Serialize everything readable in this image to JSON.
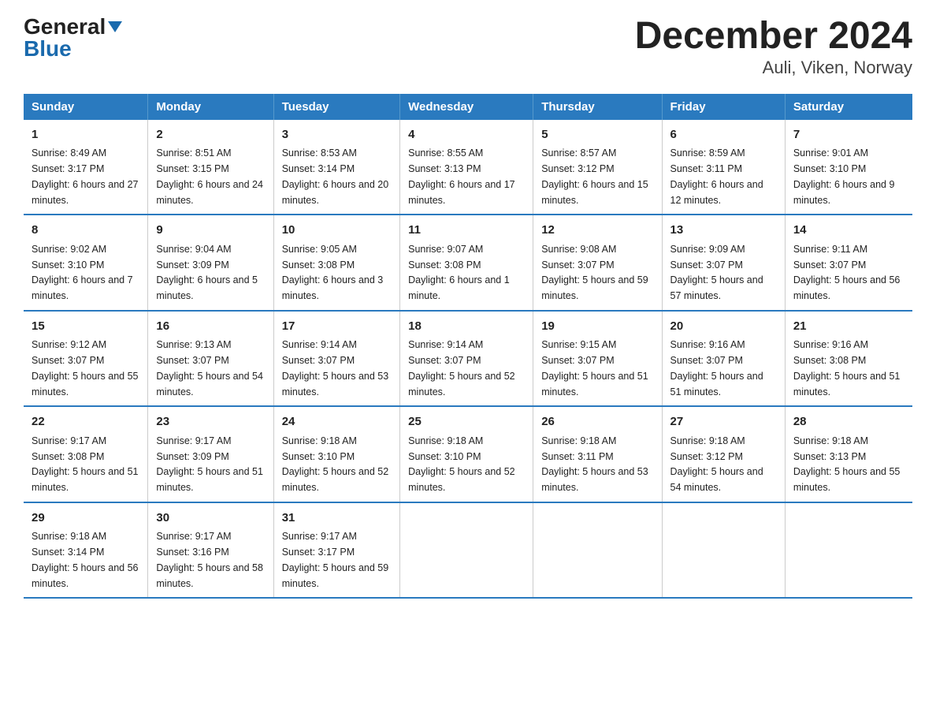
{
  "logo": {
    "general": "General",
    "blue": "Blue"
  },
  "title": "December 2024",
  "subtitle": "Auli, Viken, Norway",
  "headers": [
    "Sunday",
    "Monday",
    "Tuesday",
    "Wednesday",
    "Thursday",
    "Friday",
    "Saturday"
  ],
  "weeks": [
    [
      {
        "day": "1",
        "sunrise": "8:49 AM",
        "sunset": "3:17 PM",
        "daylight": "6 hours and 27 minutes."
      },
      {
        "day": "2",
        "sunrise": "8:51 AM",
        "sunset": "3:15 PM",
        "daylight": "6 hours and 24 minutes."
      },
      {
        "day": "3",
        "sunrise": "8:53 AM",
        "sunset": "3:14 PM",
        "daylight": "6 hours and 20 minutes."
      },
      {
        "day": "4",
        "sunrise": "8:55 AM",
        "sunset": "3:13 PM",
        "daylight": "6 hours and 17 minutes."
      },
      {
        "day": "5",
        "sunrise": "8:57 AM",
        "sunset": "3:12 PM",
        "daylight": "6 hours and 15 minutes."
      },
      {
        "day": "6",
        "sunrise": "8:59 AM",
        "sunset": "3:11 PM",
        "daylight": "6 hours and 12 minutes."
      },
      {
        "day": "7",
        "sunrise": "9:01 AM",
        "sunset": "3:10 PM",
        "daylight": "6 hours and 9 minutes."
      }
    ],
    [
      {
        "day": "8",
        "sunrise": "9:02 AM",
        "sunset": "3:10 PM",
        "daylight": "6 hours and 7 minutes."
      },
      {
        "day": "9",
        "sunrise": "9:04 AM",
        "sunset": "3:09 PM",
        "daylight": "6 hours and 5 minutes."
      },
      {
        "day": "10",
        "sunrise": "9:05 AM",
        "sunset": "3:08 PM",
        "daylight": "6 hours and 3 minutes."
      },
      {
        "day": "11",
        "sunrise": "9:07 AM",
        "sunset": "3:08 PM",
        "daylight": "6 hours and 1 minute."
      },
      {
        "day": "12",
        "sunrise": "9:08 AM",
        "sunset": "3:07 PM",
        "daylight": "5 hours and 59 minutes."
      },
      {
        "day": "13",
        "sunrise": "9:09 AM",
        "sunset": "3:07 PM",
        "daylight": "5 hours and 57 minutes."
      },
      {
        "day": "14",
        "sunrise": "9:11 AM",
        "sunset": "3:07 PM",
        "daylight": "5 hours and 56 minutes."
      }
    ],
    [
      {
        "day": "15",
        "sunrise": "9:12 AM",
        "sunset": "3:07 PM",
        "daylight": "5 hours and 55 minutes."
      },
      {
        "day": "16",
        "sunrise": "9:13 AM",
        "sunset": "3:07 PM",
        "daylight": "5 hours and 54 minutes."
      },
      {
        "day": "17",
        "sunrise": "9:14 AM",
        "sunset": "3:07 PM",
        "daylight": "5 hours and 53 minutes."
      },
      {
        "day": "18",
        "sunrise": "9:14 AM",
        "sunset": "3:07 PM",
        "daylight": "5 hours and 52 minutes."
      },
      {
        "day": "19",
        "sunrise": "9:15 AM",
        "sunset": "3:07 PM",
        "daylight": "5 hours and 51 minutes."
      },
      {
        "day": "20",
        "sunrise": "9:16 AM",
        "sunset": "3:07 PM",
        "daylight": "5 hours and 51 minutes."
      },
      {
        "day": "21",
        "sunrise": "9:16 AM",
        "sunset": "3:08 PM",
        "daylight": "5 hours and 51 minutes."
      }
    ],
    [
      {
        "day": "22",
        "sunrise": "9:17 AM",
        "sunset": "3:08 PM",
        "daylight": "5 hours and 51 minutes."
      },
      {
        "day": "23",
        "sunrise": "9:17 AM",
        "sunset": "3:09 PM",
        "daylight": "5 hours and 51 minutes."
      },
      {
        "day": "24",
        "sunrise": "9:18 AM",
        "sunset": "3:10 PM",
        "daylight": "5 hours and 52 minutes."
      },
      {
        "day": "25",
        "sunrise": "9:18 AM",
        "sunset": "3:10 PM",
        "daylight": "5 hours and 52 minutes."
      },
      {
        "day": "26",
        "sunrise": "9:18 AM",
        "sunset": "3:11 PM",
        "daylight": "5 hours and 53 minutes."
      },
      {
        "day": "27",
        "sunrise": "9:18 AM",
        "sunset": "3:12 PM",
        "daylight": "5 hours and 54 minutes."
      },
      {
        "day": "28",
        "sunrise": "9:18 AM",
        "sunset": "3:13 PM",
        "daylight": "5 hours and 55 minutes."
      }
    ],
    [
      {
        "day": "29",
        "sunrise": "9:18 AM",
        "sunset": "3:14 PM",
        "daylight": "5 hours and 56 minutes."
      },
      {
        "day": "30",
        "sunrise": "9:17 AM",
        "sunset": "3:16 PM",
        "daylight": "5 hours and 58 minutes."
      },
      {
        "day": "31",
        "sunrise": "9:17 AM",
        "sunset": "3:17 PM",
        "daylight": "5 hours and 59 minutes."
      },
      null,
      null,
      null,
      null
    ]
  ]
}
